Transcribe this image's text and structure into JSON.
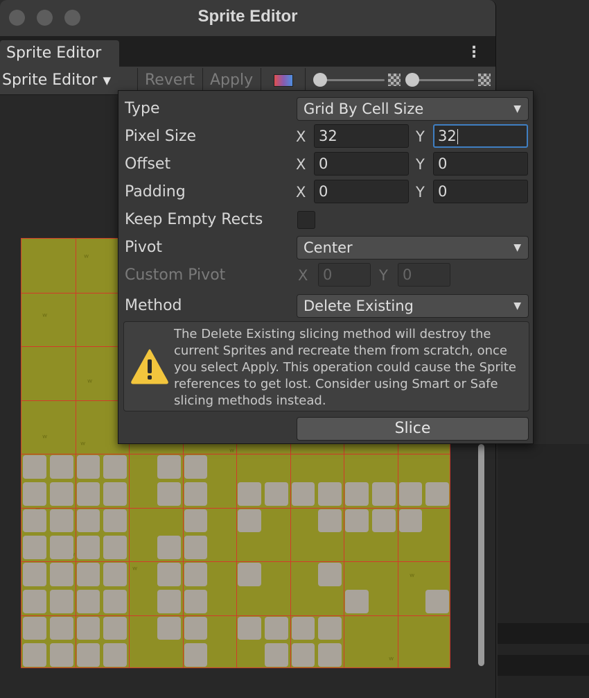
{
  "window": {
    "title": "Sprite Editor",
    "tab_label": "Sprite Editor",
    "more_icon": "kebab-menu-icon"
  },
  "toolbar": {
    "mode_dropdown": "Sprite Editor",
    "revert_label": "Revert",
    "apply_label": "Apply"
  },
  "slice_popup": {
    "type_label": "Type",
    "type_value": "Grid By Cell Size",
    "pixel_size_label": "Pixel Size",
    "pixel_size_x": "32",
    "pixel_size_y": "32",
    "offset_label": "Offset",
    "offset_x": "0",
    "offset_y": "0",
    "padding_label": "Padding",
    "padding_x": "0",
    "padding_y": "0",
    "keep_empty_label": "Keep Empty Rects",
    "keep_empty_checked": false,
    "pivot_label": "Pivot",
    "pivot_value": "Center",
    "custom_pivot_label": "Custom Pivot",
    "custom_pivot_x": "0",
    "custom_pivot_y": "0",
    "method_label": "Method",
    "method_value": "Delete Existing",
    "warning_text": "The Delete Existing slicing method will destroy the current Sprites and recreate them from scratch, once you select Apply. This operation could cause the Sprite references to get lost. Consider using Smart or Safe slicing methods instead.",
    "slice_button": "Slice",
    "x_axis": "X",
    "y_axis": "Y"
  },
  "colors": {
    "grass": "#8f8f25",
    "grid_line": "#d23a2a",
    "focus_border": "#3f7fc2",
    "warning_yellow": "#f2c53d"
  }
}
